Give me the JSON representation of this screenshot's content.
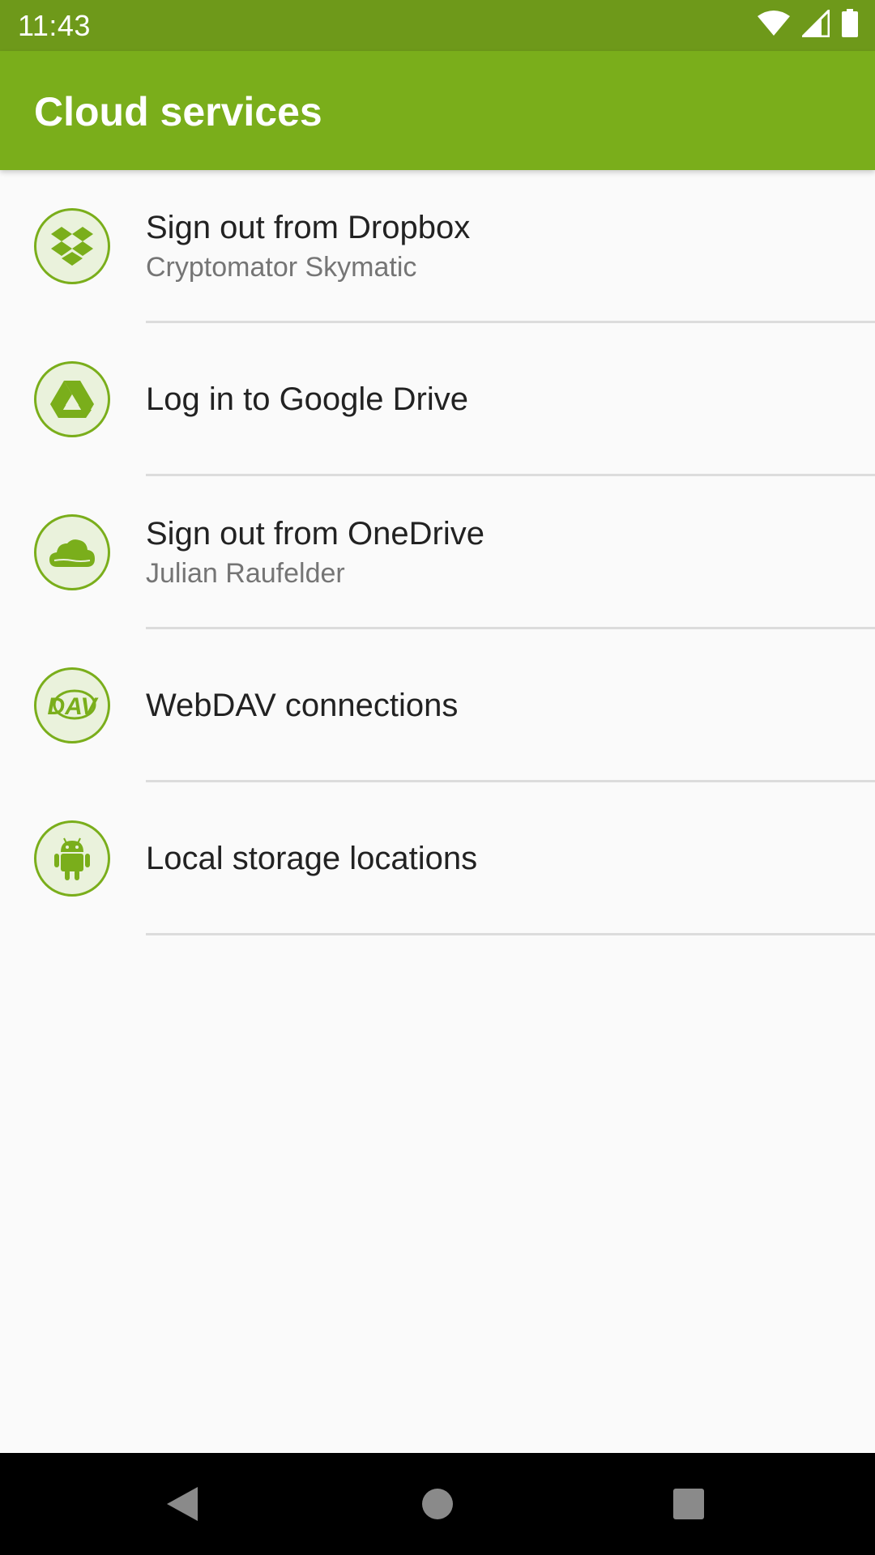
{
  "status_bar": {
    "time": "11:43",
    "icons": [
      "wifi-icon",
      "cellular-signal-icon",
      "battery-icon"
    ]
  },
  "app_bar": {
    "title": "Cloud services",
    "color": "#7aae1b"
  },
  "list": {
    "items": [
      {
        "icon": "dropbox-icon",
        "title": "Sign out from Dropbox",
        "subtitle": "Cryptomator Skymatic"
      },
      {
        "icon": "google-drive-icon",
        "title": "Log in to Google Drive",
        "subtitle": ""
      },
      {
        "icon": "onedrive-icon",
        "title": "Sign out from OneDrive",
        "subtitle": "Julian Raufelder"
      },
      {
        "icon": "webdav-icon",
        "title": "WebDAV connections",
        "subtitle": ""
      },
      {
        "icon": "android-icon",
        "title": "Local storage locations",
        "subtitle": ""
      }
    ]
  },
  "nav_bar": {
    "buttons": [
      "back-icon",
      "home-icon",
      "recents-icon"
    ]
  },
  "colors": {
    "status_bar": "#6e991a",
    "accent": "#7aae1b",
    "icon_bg": "#eaf2dc",
    "background": "#fafafa"
  }
}
